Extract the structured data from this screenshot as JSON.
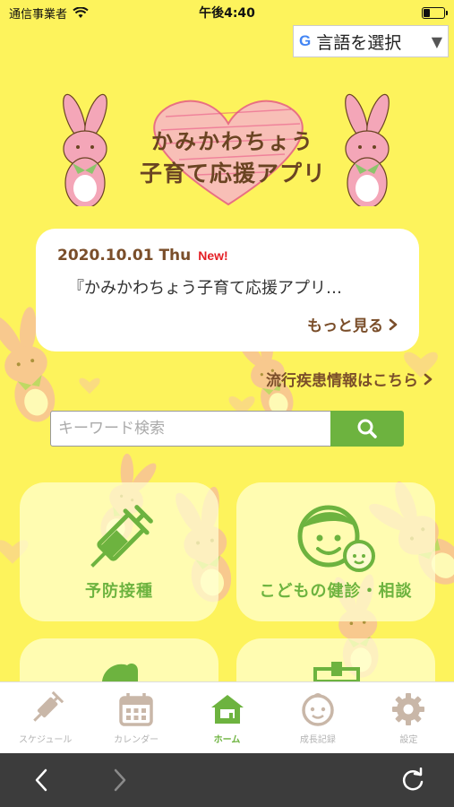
{
  "status_bar": {
    "carrier": "通信事業者",
    "time": "午後4:40",
    "battery_level": 0.3
  },
  "translate_widget": {
    "g_logo": "G",
    "label": "言語を選択",
    "arrow": "▼"
  },
  "header": {
    "title_line1": "かみかわちょう",
    "title_line2": "子育て応援アプリ"
  },
  "news": {
    "date": "2020.10.01 Thu",
    "badge": "New!",
    "title": "『かみかわちょう子育て応援アプリ…",
    "more_label": "もっと見る"
  },
  "epidemic_link": {
    "label": "流行疾患情報はこちら"
  },
  "search": {
    "placeholder": "キーワード検索",
    "value": ""
  },
  "tiles": [
    {
      "label": "予防接種",
      "icon": "syringe-icon"
    },
    {
      "label": "こどもの健診・相談",
      "icon": "child-face-icon"
    }
  ],
  "tabbar": {
    "items": [
      {
        "label": "スケジュール",
        "icon": "syringe-icon",
        "active": false
      },
      {
        "label": "カレンダー",
        "icon": "calendar-icon",
        "active": false
      },
      {
        "label": "ホーム",
        "icon": "home-icon",
        "active": true
      },
      {
        "label": "成長記録",
        "icon": "baby-face-icon",
        "active": false
      },
      {
        "label": "設定",
        "icon": "gear-icon",
        "active": false
      }
    ]
  },
  "browser_bar": {
    "back": "back-icon",
    "forward": "forward-icon",
    "reload": "reload-icon"
  },
  "colors": {
    "background": "#fdf35c",
    "accent_green": "#6db33f",
    "text_brown": "#7a4e2a",
    "new_red": "#e41f25",
    "rabbit_pink": "#f4a6b8"
  }
}
